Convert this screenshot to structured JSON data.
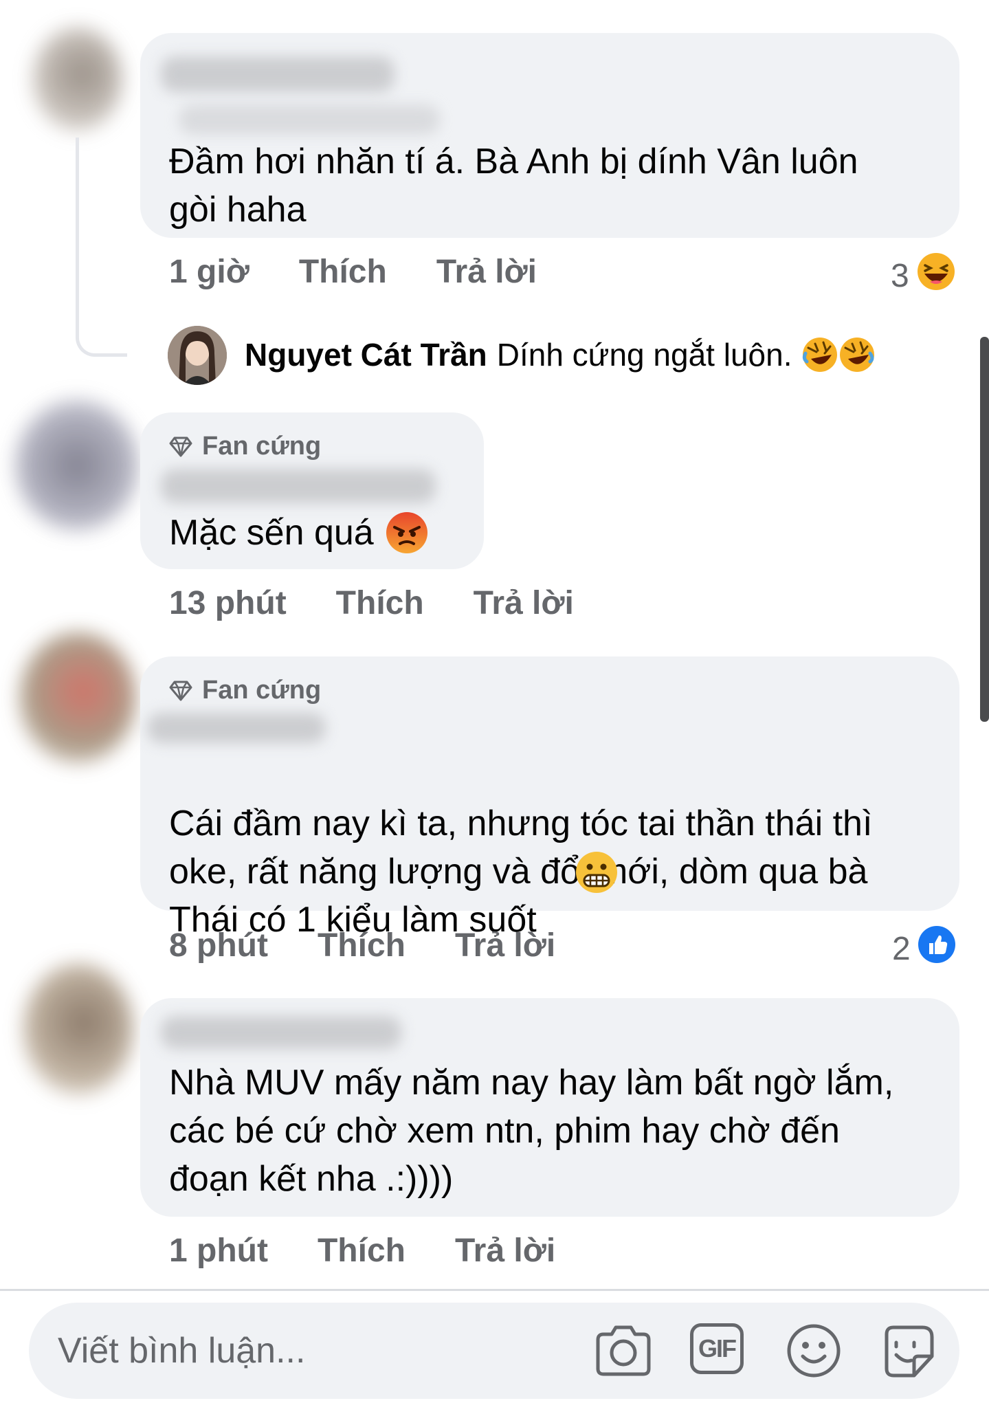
{
  "comments": [
    {
      "text": "Đầm hơi nhăn tí á. Bà Anh bị dính Vân luôn\ngòi haha",
      "time": "1 giờ",
      "like": "Thích",
      "reply": "Trả lời",
      "reaction_count": "3",
      "reaction_icon": "haha-emoji-icon",
      "replies": [
        {
          "author": "Nguyet Cát Trần",
          "text": "Dính cứng ngắt luôn."
        }
      ]
    },
    {
      "badge": "Fan cứng",
      "text": "Mặc sến quá",
      "time": "13 phút",
      "like": "Thích",
      "reply": "Trả lời"
    },
    {
      "badge": "Fan cứng",
      "text": "Cái đầm nay kì ta, nhưng tóc tai thần thái thì\noke, rất năng lượng và đổi mới, dòm qua bà\nThái có 1 kiểu làm suốt",
      "time": "8 phút",
      "like": "Thích",
      "reply": "Trả lời",
      "reaction_count": "2",
      "reaction_icon": "like-icon"
    },
    {
      "text": "Nhà MUV mấy năm nay hay làm bất ngờ lắm,\ncác bé cứ chờ xem ntn, phim hay chờ đến\nđoạn kết nha .:))))",
      "time": "1 phút",
      "like": "Thích",
      "reply": "Trả lời"
    }
  ],
  "composer": {
    "placeholder": "Viết bình luận...",
    "gif_label": "GIF",
    "icons": [
      "camera-icon",
      "gif-icon",
      "emoji-icon",
      "sticker-icon"
    ]
  },
  "colors": {
    "bubble": "#f0f2f5",
    "secondary_text": "#65676b",
    "like_blue": "#1877f2"
  }
}
